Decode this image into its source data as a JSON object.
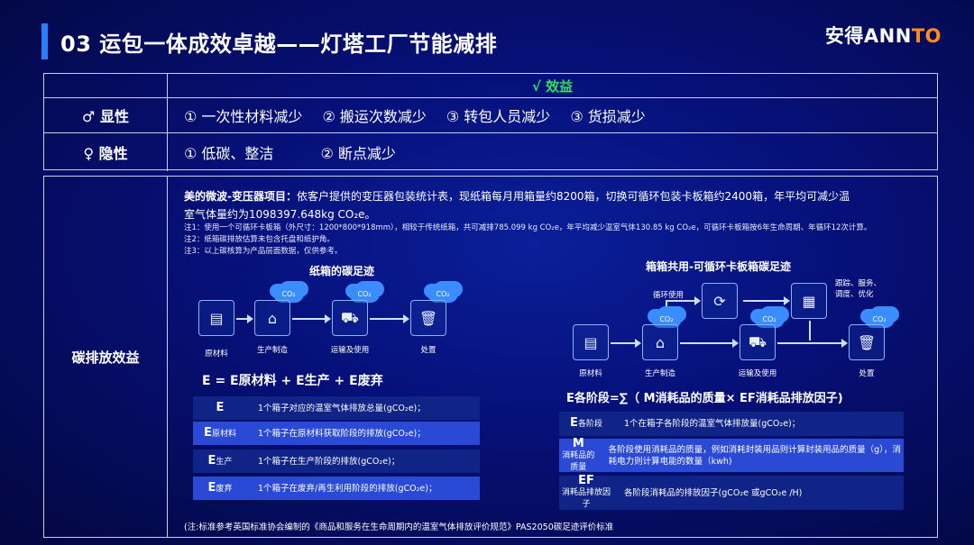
{
  "header": {
    "title": "03 运包一体成效卓越——灯塔工厂节能减排",
    "logo_main": "安得ANN",
    "logo_accent": "TO"
  },
  "benefits": {
    "head": "√ 效益",
    "explicit_label": "♂ 显性",
    "explicit_items": [
      "① 一次性材料减少",
      "② 搬运次数减少",
      "③ 转包人员减少",
      "③ 货损减少"
    ],
    "implicit_label": "♀ 隐性",
    "implicit_items": [
      "① 低碳、整洁",
      "② 断点减少"
    ]
  },
  "carbon": {
    "label": "碳排放效益",
    "main_bold": "美的微波-变压器项目：",
    "main_line1": "依客户提供的变压器包装统计表，现纸箱每月用箱量约8200箱，切换可循环包装卡板箱约2400箱，年平均可减少温",
    "main_line2": "室气体量约为1098397.648kg CO₂e。",
    "note1": "注1：使用一个可循环卡板箱（外尺寸：1200*800*918mm），相较于传统纸箱，共可减排785.099 kg CO₂e，年平均减少温室气体130.85 kg CO₂e，可循环卡板箱按6年生命周期、年循环12次计算。",
    "note2": "注2：纸箱碳排放估算未包含托盘和纸护角。",
    "note3": "注3：以上碳核算为产品层面数据，仅供参考。"
  },
  "left_diagram": {
    "title": "纸箱的碳足迹",
    "co2": "CO₂",
    "nodes": [
      "原材料",
      "生产制造",
      "运输及使用",
      "处置"
    ],
    "formula": "E = E原材料 + E生产 + E废弃",
    "defs": [
      {
        "sym": "E",
        "sub": "",
        "text": "1个箱子对应的温室气体排放总量(gCO₂e)；"
      },
      {
        "sym": "E",
        "sub": "原材料",
        "text": "1个箱子在原材料获取阶段的排放(gCO₂e)；"
      },
      {
        "sym": "E",
        "sub": "生产",
        "text": "1个箱子在生产阶段的排放(gCO₂e)；"
      },
      {
        "sym": "E",
        "sub": "废弃",
        "text": "1个箱子在废弃/再生利用阶段的排放(gCO₂e)；"
      }
    ]
  },
  "right_diagram": {
    "title": "箱箱共用-可循环卡板箱碳足迹",
    "co2": "CO₂",
    "nodes": [
      "原材料",
      "生产制造",
      "运输及使用",
      "处置"
    ],
    "loop_label": "循环使用",
    "track_label_1": "跟踪、服务、",
    "track_label_2": "调度、优化",
    "formula": "E各阶段=∑（ M消耗品的质量× EF消耗品排放因子)",
    "defs": [
      {
        "sym": "E",
        "sub": "各阶段",
        "text": "1个在箱子各阶段的温室气体排放量(gCO₂e)；"
      },
      {
        "sym": "M",
        "sub": "消耗品的质量",
        "text": "各阶段使用消耗品的质量，例如消耗封装用品则计算封装用品的质量（g），消耗电力则计算电能的数量（kwh)"
      },
      {
        "sym": "EF",
        "sub": "消耗品排放因子",
        "text": "各阶段消耗品的排放因子(gCO₂e 或gCO₂e /H)"
      }
    ]
  },
  "footnote": "(注:标准参考英国标准协会编制的《商品和服务在生命周期内的温室气体排放评价规范》PAS2050碳足迹评价标准"
}
